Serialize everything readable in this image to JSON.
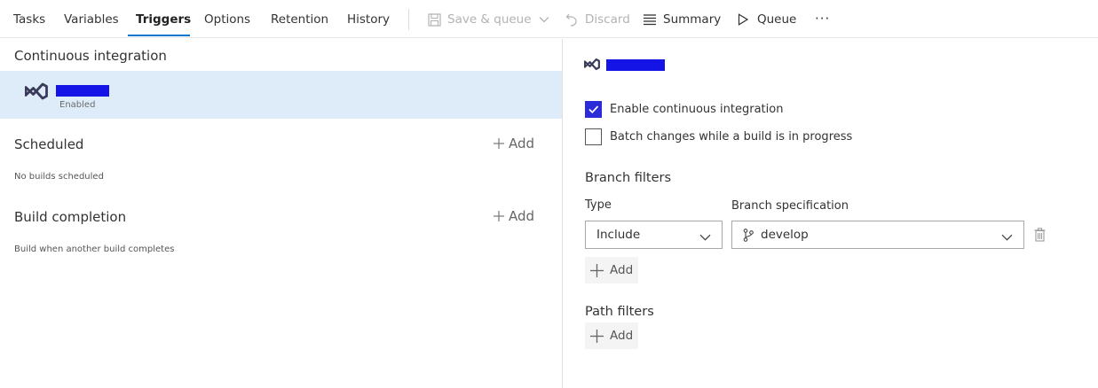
{
  "tabs": [
    {
      "label": "Tasks"
    },
    {
      "label": "Variables"
    },
    {
      "label": "Triggers",
      "active": true
    },
    {
      "label": "Options"
    },
    {
      "label": "Retention"
    },
    {
      "label": "History"
    }
  ],
  "toolbar": {
    "save_queue_label": "Save & queue",
    "discard_label": "Discard",
    "summary_label": "Summary",
    "queue_label": "Queue",
    "more_label": "···"
  },
  "left": {
    "ci": {
      "title": "Continuous integration",
      "item": {
        "status": "Enabled",
        "icon": "visual-studio-icon"
      }
    },
    "scheduled": {
      "title": "Scheduled",
      "add_label": "Add",
      "note": "No builds scheduled"
    },
    "build_completion": {
      "title": "Build completion",
      "add_label": "Add",
      "note": "Build when another build completes"
    }
  },
  "right": {
    "enable_ci": {
      "label": "Enable continuous integration",
      "checked": true
    },
    "batch_changes": {
      "label": "Batch changes while a build is in progress",
      "checked": false
    },
    "branch_filters": {
      "title": "Branch filters",
      "type_label": "Type",
      "spec_label": "Branch specification",
      "type_value": "Include",
      "spec_value": "develop",
      "add_label": "Add"
    },
    "path_filters": {
      "title": "Path filters",
      "add_label": "Add"
    }
  },
  "colors": {
    "accent": "#0078d4",
    "selected_row": "#deecf9",
    "checkbox_checked": "#2b2bd9",
    "redaction": "#1414e6"
  }
}
